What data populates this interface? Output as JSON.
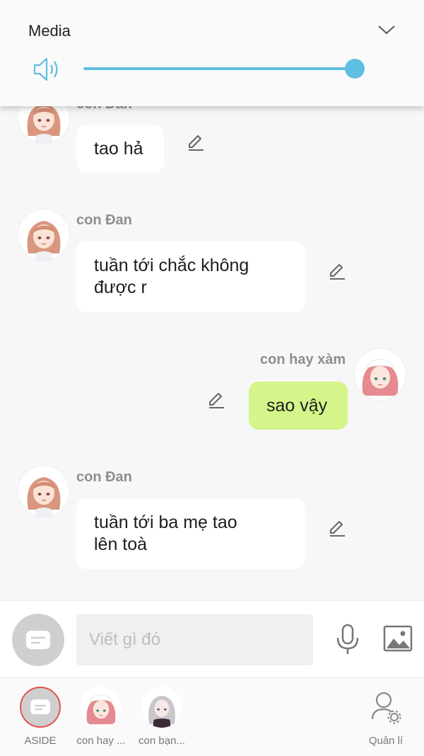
{
  "media": {
    "title": "Media",
    "volume": 1.0
  },
  "messages": [
    {
      "sender": "con Đan",
      "text": "tao hả",
      "mine": false
    },
    {
      "sender": "con Đan",
      "text_lines": [
        "tuần tới chắc không",
        "được r"
      ],
      "mine": false
    },
    {
      "sender": "con hay xàm",
      "text": "sao vậy",
      "mine": true
    },
    {
      "sender": "con Đan",
      "text_lines": [
        "tuần tới ba mẹ tao",
        "lên toà"
      ],
      "mine": false
    }
  ],
  "composer": {
    "placeholder": "Viết gì đó"
  },
  "nav": {
    "items": [
      {
        "label": "ASIDE",
        "icon": "aside-chat-icon"
      },
      {
        "label": "con hay ...",
        "icon": "avatar"
      },
      {
        "label": "con bạn...",
        "icon": "avatar"
      },
      {
        "label": "Quản lí",
        "icon": "manage-user-icon"
      }
    ]
  },
  "colors": {
    "accent": "#5fbfe0",
    "my_bubble": "#d4f58a",
    "other_bubble": "#ffffff"
  }
}
